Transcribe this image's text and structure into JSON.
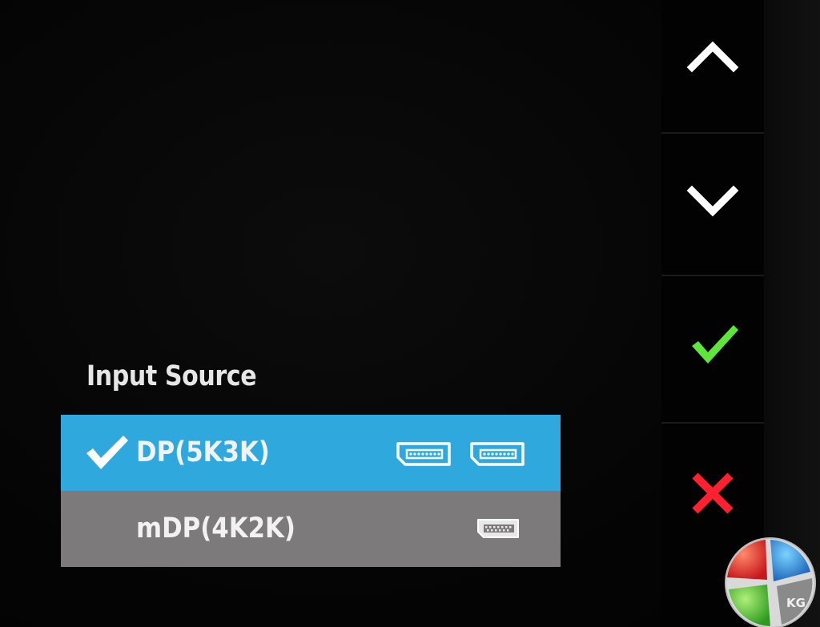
{
  "menu": {
    "title": "Input Source",
    "items": [
      {
        "label": "DP(5K3K)",
        "selected": true,
        "icons": [
          "displayport-icon",
          "displayport-icon"
        ]
      },
      {
        "label": "mDP(4K2K)",
        "selected": false,
        "icons": [
          "mini-displayport-icon"
        ]
      }
    ]
  },
  "controls": [
    {
      "name": "up",
      "icon": "chevron-up-icon",
      "color": "#ffffff"
    },
    {
      "name": "down",
      "icon": "chevron-down-icon",
      "color": "#ffffff"
    },
    {
      "name": "confirm",
      "icon": "check-icon",
      "color": "#5ee63a"
    },
    {
      "name": "exit",
      "icon": "close-icon",
      "color": "#ff2030"
    }
  ],
  "colors": {
    "selected_row": "#2fa9dd",
    "normal_row": "#7c7a7b",
    "background": "#050505"
  },
  "watermark": {
    "text": "KG",
    "icon": "kitguru-logo-icon"
  }
}
